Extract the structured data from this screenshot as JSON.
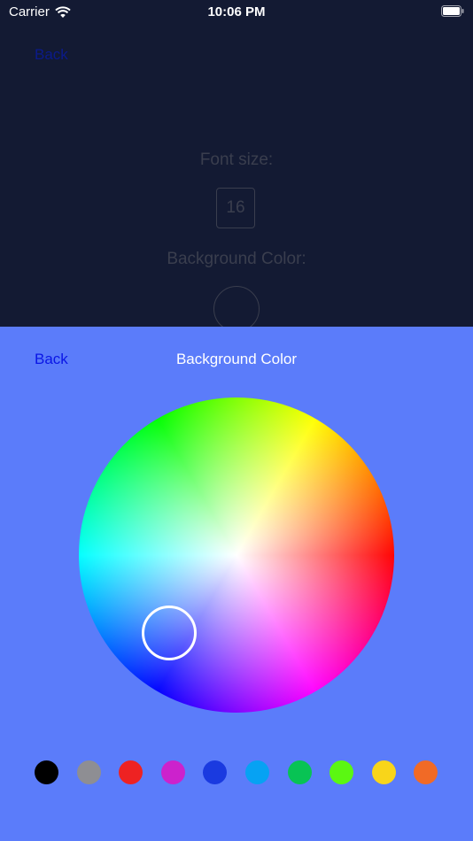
{
  "status_bar": {
    "carrier": "Carrier",
    "time": "10:06 PM"
  },
  "background_screen": {
    "back_label": "Back",
    "font_size_label": "Font size:",
    "font_size_value": "16",
    "background_color_label": "Background Color:"
  },
  "picker": {
    "back_label": "Back",
    "title": "Background Color",
    "sheet_color": "#5b7cfa",
    "swatches": [
      {
        "color": "#000000"
      },
      {
        "color": "#8e8e93"
      },
      {
        "color": "#ee2222"
      },
      {
        "color": "#cc22cc"
      },
      {
        "color": "#1a3ae0"
      },
      {
        "color": "#06a2f3"
      },
      {
        "color": "#08c354"
      },
      {
        "color": "#5bf712"
      },
      {
        "color": "#f8d51a"
      },
      {
        "color": "#f16a26"
      }
    ]
  }
}
